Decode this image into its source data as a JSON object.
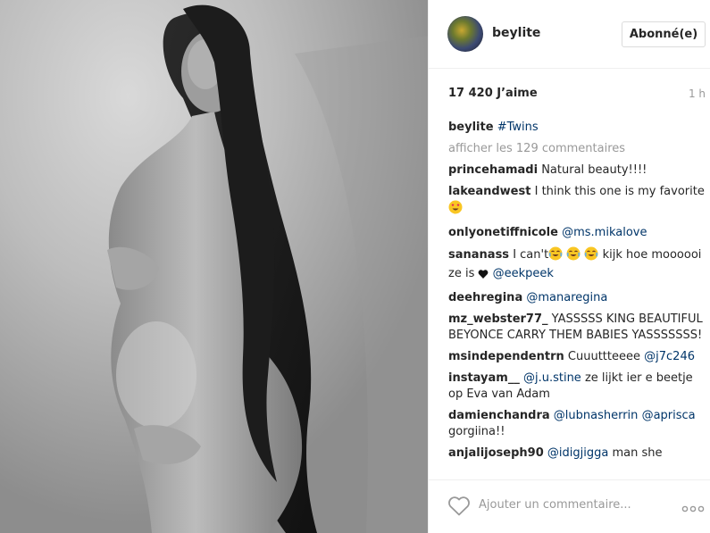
{
  "photo": {
    "alt": ""
  },
  "header": {
    "username": "beylite",
    "follow_label": "Abonné(e)"
  },
  "stats": {
    "likes": "17 420 J’aime",
    "time": "1 h"
  },
  "caption": {
    "user": "beylite",
    "tag": "#Twins"
  },
  "view_all": "afficher les 129 commentaires",
  "comments": [
    {
      "user": "princehamadi",
      "text": "Natural beauty!!!!"
    },
    {
      "user": "lakeandwest",
      "text": "I think this one is my favorite"
    },
    {
      "user": "onlyonetiffnicole",
      "tag": "@ms.mikalove"
    },
    {
      "user": "sananass",
      "text_a": "I can't",
      "text_b": "kijk hoe moooooi ze is",
      "tag": "@eekpeek"
    },
    {
      "user": "deehregina",
      "tag": "@manaregina"
    },
    {
      "user": "mz_webster77_",
      "text": "YASSSSS KING BEAUTIFUL BEYONCE CARRY THEM BABIES YASSSSSSS!"
    },
    {
      "user": "msindependentrn",
      "text": "Cuuuttteeee",
      "tag": "@j7c246"
    },
    {
      "user": "instayam__",
      "tag": "@j.u.stine",
      "text": "ze lijkt ier e beetje op Eva van Adam"
    },
    {
      "user": "damienchandra",
      "tag": "@lubnasherrin",
      "tag2": "@aprisca",
      "text": "gorgiina!!"
    },
    {
      "user": "anjalijoseph90",
      "tag": "@idigjigga",
      "text": "man she"
    }
  ],
  "footer": {
    "comment_placeholder": "Ajouter un commentaire...",
    "more_label": "ooo"
  },
  "colors": {
    "link": "#003569",
    "muted": "#999999",
    "text": "#262626",
    "border": "#efefef"
  },
  "icons": [
    "heart-icon",
    "more-options-icon",
    "heart-eyes-emoji",
    "laughing-crying-emoji",
    "black-heart-emoji"
  ]
}
